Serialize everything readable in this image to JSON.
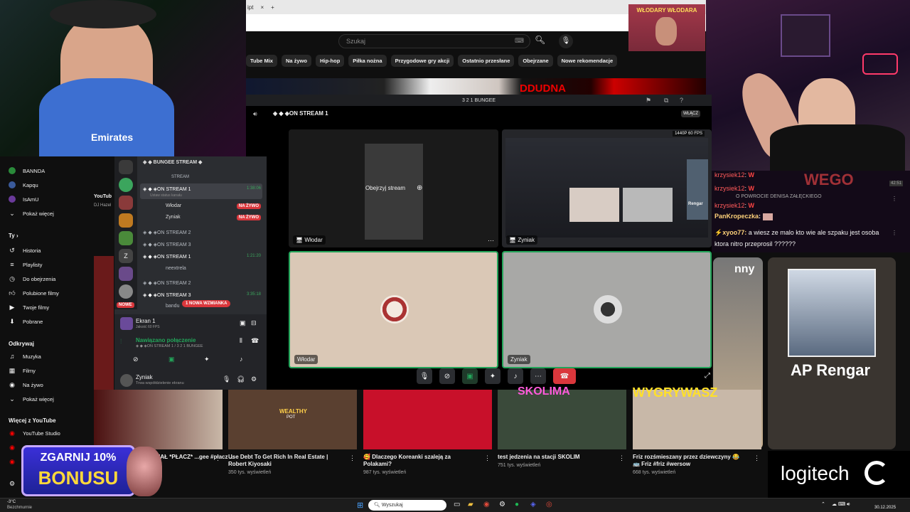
{
  "browser": {
    "tab_fragment": "ipt",
    "close": "×",
    "new_tab": "+"
  },
  "youtube": {
    "search_placeholder": "Szukaj",
    "chips": [
      "Tube Mix",
      "Na żywo",
      "Hip-hop",
      "Piłka nożna",
      "Przygodowe gry akcji",
      "Ostatnio przesłane",
      "Obejrzane",
      "Nowe rekomendacje"
    ],
    "banner_text": "WŁODARY WŁODARA",
    "thumb_text": "DDUDNA"
  },
  "sidebar": {
    "top_items": [
      {
        "label": "BANNDA",
        "icon": "channel-avatar"
      },
      {
        "label": "Kapqu",
        "icon": "channel-avatar"
      },
      {
        "label": "IsAmU",
        "icon": "channel-avatar"
      },
      {
        "label": "Pokaż więcej",
        "icon": "chevron-down-icon"
      }
    ],
    "you_heading": "Ty",
    "you_items": [
      {
        "label": "Historia",
        "icon": "history-icon"
      },
      {
        "label": "Playlisty",
        "icon": "playlist-icon"
      },
      {
        "label": "Do obejrzenia",
        "icon": "clock-icon"
      },
      {
        "label": "Polubione filmy",
        "icon": "like-icon"
      },
      {
        "label": "Twoje filmy",
        "icon": "video-icon"
      },
      {
        "label": "Pobrane",
        "icon": "download-icon"
      }
    ],
    "explore_heading": "Odkrywaj",
    "explore_items": [
      {
        "label": "Muzyka",
        "icon": "music-icon"
      },
      {
        "label": "Filmy",
        "icon": "film-icon"
      },
      {
        "label": "Na żywo",
        "icon": "live-icon"
      },
      {
        "label": "Pokaż więcej",
        "icon": "chevron-down-icon"
      }
    ],
    "more_heading": "Więcej z YouTube",
    "more_items": [
      {
        "label": "YouTube Studio",
        "icon": "studio-icon"
      }
    ],
    "partial_video": {
      "title": "YouTub",
      "channel": "DJ Hazel"
    }
  },
  "discord": {
    "title": "3 2 1 BUNGEE",
    "header": "◈ ◆ ◈ON STREAM 1",
    "watch_label": "Obejrzyj stream",
    "join_button": "WŁĄCZ",
    "tiles": [
      {
        "name": "Włodar"
      },
      {
        "name": "Zyniak",
        "quality": "1440P 60 FPS"
      },
      {
        "name": "Włodar"
      },
      {
        "name": "Zyniak"
      }
    ],
    "thumb_overlay": "Rengar"
  },
  "channels": {
    "category": "◈ ◆ BUNGEE STREAM ◆",
    "divider": "STREAM",
    "items": [
      {
        "name": "◈ ◆ ◈ON STREAM 1",
        "sub": "Ustaw status kanału",
        "time": "1:38:06"
      },
      {
        "name": "Włodar",
        "badge": "NA ŻYWO"
      },
      {
        "name": "Zyniak",
        "badge": "NA ŻYWO"
      },
      {
        "name": "◈ ◆ ◈ON STREAM 2"
      },
      {
        "name": "◈ ◆ ◈ON STREAM 3"
      },
      {
        "name": "◈ ◆ ◈ON STREAM 1",
        "time": "1:21:20"
      },
      {
        "name": "neextrela"
      },
      {
        "name": "◈ ◆ ◈ON STREAM 2"
      },
      {
        "name": "◈ ◆ ◈ON STREAM 3",
        "time": "3:35:18"
      },
      {
        "name": "bandu"
      }
    ],
    "new_badge": "NOWE",
    "mention_badge": "1 NOWA WZMIANKA",
    "screen_share": {
      "title": "Ekran 1",
      "sub": "Jakość 60 FPS"
    },
    "connection": {
      "title": "Nawiązano połączenie",
      "sub": "◈ ◆ ◈ON STREAM 1 / 3 2 1 BUNGEE"
    },
    "user": {
      "name": "Zyniak",
      "status": "Trwa współdzielenie ekranu"
    },
    "server_badges": [
      "26",
      "15",
      "34",
      "3"
    ]
  },
  "chat": {
    "pinned": "O POWROCIE DENISA ZAŁĘCKIEGO",
    "messages": [
      {
        "user": "krzysiek12",
        "text": "W"
      },
      {
        "user": "krzysiek12",
        "text": "W"
      },
      {
        "user": "krzysiek12",
        "text": "W"
      },
      {
        "user": "PanKropeczka",
        "text": ""
      },
      {
        "user": "xyoo77",
        "text": "a wiesz ze malo kto wie ale szpaku jest osoba ktora nitro przeprosil ??????"
      }
    ],
    "overlay_text": "WEGO",
    "timestamp": "42:51"
  },
  "videos": [
    {
      "title": "WYRYMAŁ *PŁACZ* ...gee #płacz ...",
      "views": ""
    },
    {
      "title": "Use Debt To Get Rich In Real Estate | Robert Kiyosaki",
      "views": "350 tys. wyświetleń"
    },
    {
      "title": "Dlaczego Koreanki szaleją za Polakami?",
      "views": "987 tys. wyświetleń"
    },
    {
      "title": "test jedzenia na stacji SKOLIM",
      "views": "751 tys. wyświetleń"
    },
    {
      "title": "Friz rozśmieszany przez dziewczyny 😂 🚌 Friz #friz #wersow",
      "views": "668 tys. wyświetleń"
    }
  ],
  "thumb_texts": {
    "skolima": "SKOLIMA",
    "wygrywasz": "WYGRYWASZ",
    "funny": "nny",
    "wealthy": "WEALTHY",
    "pot": "POT"
  },
  "rengar_label": "AP Rengar",
  "promo": {
    "line1": "ZGARNIJ 10%",
    "line2": "BONUSU"
  },
  "logitech": "logitech",
  "taskbar": {
    "weather_temp": "-3°C",
    "weather_desc": "Bezchmurnie",
    "search": "Wyszukaj",
    "time": "",
    "date": "30.12.2025"
  },
  "colors": {
    "accent_red": "#ff0000",
    "discord_green": "#23a55a",
    "discord_live": "#da373c",
    "promo_border": "#c6a8ff"
  }
}
